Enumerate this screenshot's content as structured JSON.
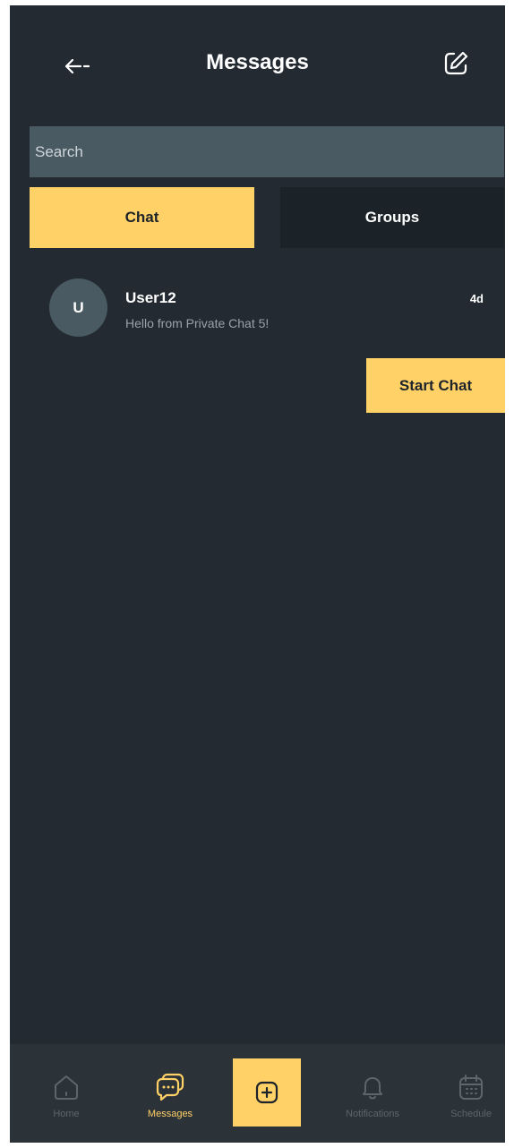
{
  "header": {
    "title": "Messages",
    "back_icon": "arrow-left-icon",
    "compose_icon": "compose-icon"
  },
  "search": {
    "placeholder": "Search",
    "value": ""
  },
  "tabs": [
    {
      "label": "Chat",
      "active": true
    },
    {
      "label": "Groups",
      "active": false
    }
  ],
  "chats": [
    {
      "avatar_letter": "U",
      "name": "User12",
      "preview": "Hello from Private Chat 5!",
      "time": "4d"
    }
  ],
  "start_chat_label": "Start Chat",
  "bottom_nav": {
    "items": [
      {
        "label": "Home",
        "icon": "home-icon",
        "active": false
      },
      {
        "label": "Messages",
        "icon": "messages-icon",
        "active": true
      },
      {
        "label": "Notifications",
        "icon": "bell-icon",
        "active": false
      },
      {
        "label": "Schedule",
        "icon": "calendar-icon",
        "active": false
      }
    ],
    "add_icon": "plus-square-icon"
  },
  "colors": {
    "background": "#232a31",
    "accent": "#ffd166",
    "search_bg": "#4a5a63",
    "inactive_tab": "#1c2328",
    "nav_bg": "#2b3238"
  }
}
